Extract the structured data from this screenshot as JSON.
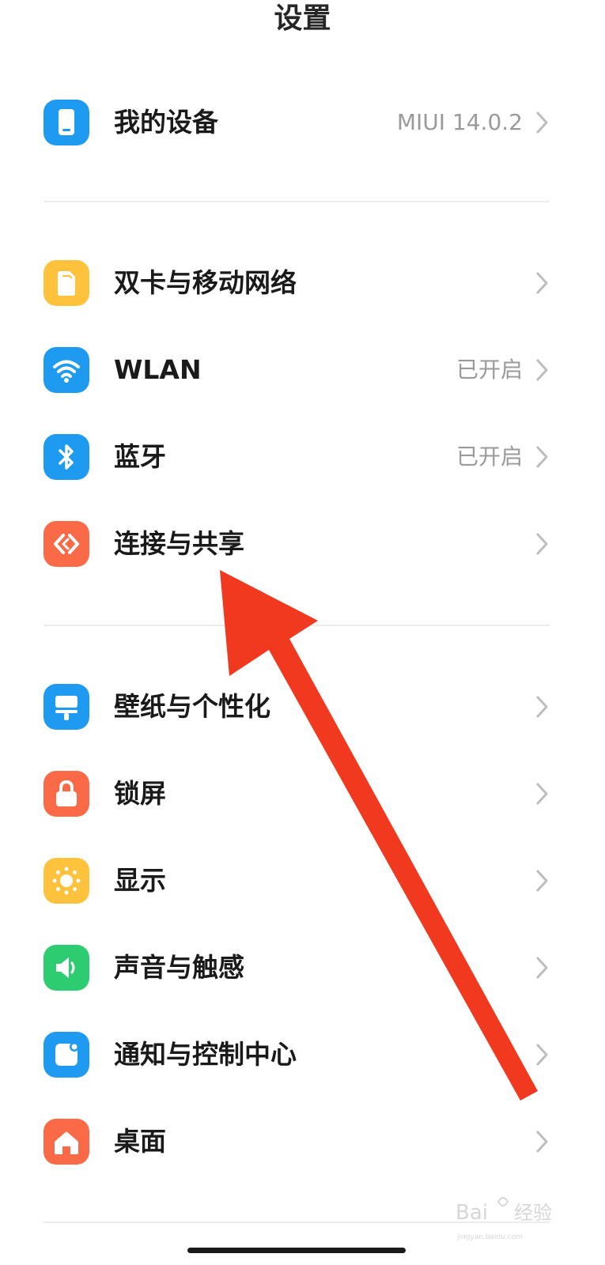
{
  "header": {
    "title": "设置"
  },
  "rows": [
    {
      "id": "my-device",
      "label": "我的设备",
      "value": "MIUI 14.0.2",
      "icon": "phone-icon",
      "color": "#1e9bf0"
    },
    {
      "id": "sim-network",
      "label": "双卡与移动网络",
      "value": "",
      "icon": "sim-card-icon",
      "color": "#ffc23d"
    },
    {
      "id": "wlan",
      "label": "WLAN",
      "value": "已开启",
      "icon": "wifi-icon",
      "color": "#1e9bf0"
    },
    {
      "id": "bluetooth",
      "label": "蓝牙",
      "value": "已开启",
      "icon": "bluetooth-icon",
      "color": "#1e9bf0"
    },
    {
      "id": "connection-sharing",
      "label": "连接与共享",
      "value": "",
      "icon": "connection-icon",
      "color": "#fa6a47"
    },
    {
      "id": "wallpaper",
      "label": "壁纸与个性化",
      "value": "",
      "icon": "wallpaper-brush-icon",
      "color": "#1e9bf0"
    },
    {
      "id": "lock-screen",
      "label": "锁屏",
      "value": "",
      "icon": "lock-icon",
      "color": "#fa6a47"
    },
    {
      "id": "display",
      "label": "显示",
      "value": "",
      "icon": "sun-icon",
      "color": "#ffc23d"
    },
    {
      "id": "sound",
      "label": "声音与触感",
      "value": "",
      "icon": "speaker-icon",
      "color": "#2ecc71"
    },
    {
      "id": "notifications",
      "label": "通知与控制中心",
      "value": "",
      "icon": "notification-icon",
      "color": "#1e9bf0"
    },
    {
      "id": "home-screen",
      "label": "桌面",
      "value": "",
      "icon": "home-icon",
      "color": "#fa6a47"
    }
  ],
  "annotation": {
    "arrow_color": "#f0391f"
  },
  "watermark": {
    "text": "jingyan.baidu.com"
  }
}
